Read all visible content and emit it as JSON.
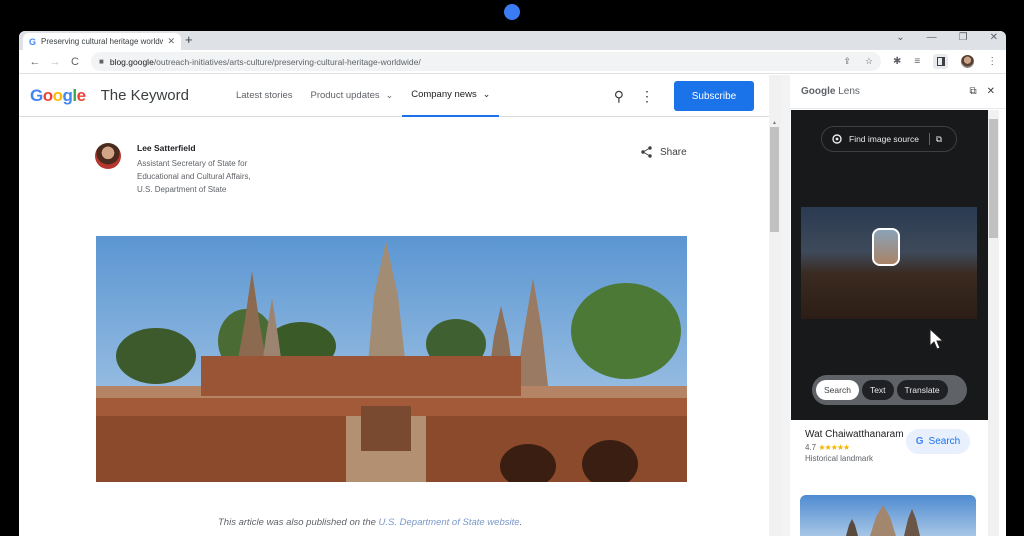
{
  "browser": {
    "tab_title": "Preserving cultural heritage worldwide",
    "tab_favicon": "G",
    "url_host": "blog.google",
    "url_path": "/outreach-initiatives/arts-culture/preserving-cultural-heritage-worldwide/",
    "icons": {
      "back": "←",
      "forward": "→",
      "reload": "C",
      "lock": "🔒",
      "share": "⇪",
      "star": "☆",
      "extensions": "✱",
      "media": "≡",
      "more": "⋮",
      "minimize": "—",
      "restore": "❐",
      "close": "✕",
      "tablist": "⌄",
      "newtab": "+",
      "tabclose": "✕"
    }
  },
  "site": {
    "logo_letters": [
      "G",
      "o",
      "o",
      "g",
      "l",
      "e"
    ],
    "name": "The Keyword",
    "nav": [
      {
        "label": "Latest stories",
        "has_menu": false,
        "active": false
      },
      {
        "label": "Product updates",
        "has_menu": true,
        "active": false
      },
      {
        "label": "Company news",
        "has_menu": true,
        "active": true
      }
    ],
    "chevron": "⌄",
    "search_icon": "⚲",
    "more_icon": "⋮",
    "subscribe_label": "Subscribe"
  },
  "article": {
    "author_name": "Lee Satterfield",
    "author_role": "Assistant Secretary of State for Educational and Cultural Affairs, U.S. Department of State",
    "share_label": "Share",
    "share_icon": "<",
    "image_alt": "Wat Chaiwatthanaram temple ruins",
    "caption_prefix": "This article was also published on the ",
    "caption_link": "U.S. Department of State website",
    "caption_suffix": "."
  },
  "lens": {
    "title_brand": "Google",
    "title_product": " Lens",
    "open_icon": "⧉",
    "close_icon": "✕",
    "find_source_label": "Find image source",
    "modes": [
      {
        "label": "Search",
        "active": true
      },
      {
        "label": "Text",
        "active": false
      },
      {
        "label": "Translate",
        "active": false
      }
    ],
    "result": {
      "name": "Wat Chaiwatthanaram",
      "rating": "4.7",
      "stars": "★★★★★",
      "type": "Historical landmark",
      "search_label": "Search",
      "search_g": "G"
    },
    "cursor": "➤"
  },
  "colors": {
    "accent": "#1a73e8",
    "camera_dot": "#3b7cf5",
    "lens_dark": "#18191b"
  }
}
